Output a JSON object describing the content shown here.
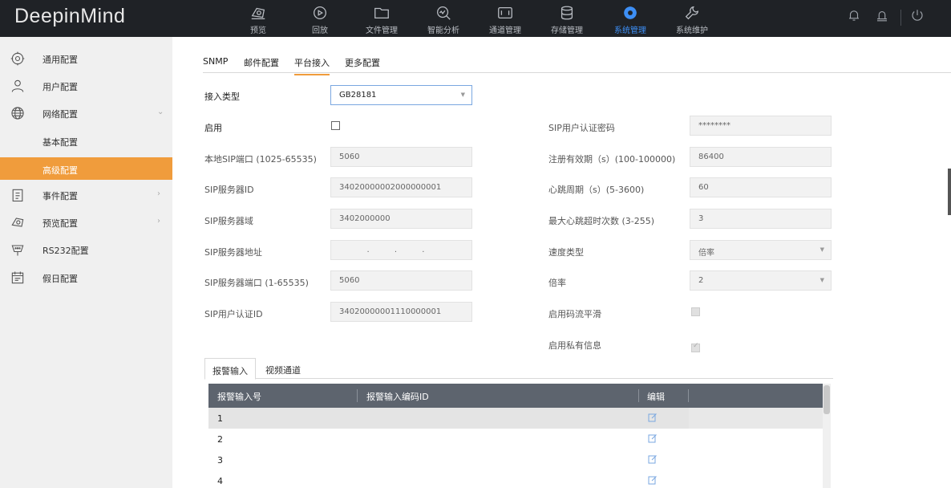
{
  "app": {
    "logo": "DeepinMind"
  },
  "nav": [
    {
      "label": "预览",
      "icon": "preview-icon"
    },
    {
      "label": "回放",
      "icon": "playback-icon"
    },
    {
      "label": "文件管理",
      "icon": "folder-icon"
    },
    {
      "label": "智能分析",
      "icon": "analysis-icon"
    },
    {
      "label": "通道管理",
      "icon": "channel-icon"
    },
    {
      "label": "存储管理",
      "icon": "database-icon"
    },
    {
      "label": "系统管理",
      "icon": "gear-icon",
      "active": true
    },
    {
      "label": "系统维护",
      "icon": "wrench-icon"
    }
  ],
  "sidebar": {
    "items": [
      {
        "label": "通用配置",
        "icon": "settings-icon"
      },
      {
        "label": "用户配置",
        "icon": "user-icon"
      },
      {
        "label": "网络配置",
        "icon": "globe-icon"
      },
      {
        "label": "基本配置"
      },
      {
        "label": "高级配置",
        "active": true
      },
      {
        "label": "事件配置",
        "icon": "clipboard-icon"
      },
      {
        "label": "预览配置",
        "icon": "preview-icon"
      },
      {
        "label": "RS232配置",
        "icon": "rs232-icon"
      },
      {
        "label": "假日配置",
        "icon": "calendar-icon"
      }
    ]
  },
  "tabs": [
    "SNMP",
    "邮件配置",
    "平台接入",
    "更多配置"
  ],
  "form": {
    "access_type_label": "接入类型",
    "access_type_value": "GB28181",
    "enable_label": "启用",
    "local_sip_port_label": "本地SIP端口 (1025-65535)",
    "local_sip_port_value": "5060",
    "sip_server_id_label": "SIP服务器ID",
    "sip_server_id_value": "34020000002000000001",
    "sip_server_domain_label": "SIP服务器域",
    "sip_server_domain_value": "3402000000",
    "sip_server_addr_label": "SIP服务器地址",
    "sip_server_addr_value": ". . .",
    "sip_server_port_label": "SIP服务器端口 (1-65535)",
    "sip_server_port_value": "5060",
    "sip_user_auth_id_label": "SIP用户认证ID",
    "sip_user_auth_id_value": "34020000001110000001",
    "sip_user_auth_pwd_label": "SIP用户认证密码",
    "sip_user_auth_pwd_value": "********",
    "reg_validity_label": "注册有效期（s）(100-100000)",
    "reg_validity_value": "86400",
    "heartbeat_label": "心跳周期（s）(5-3600)",
    "heartbeat_value": "60",
    "max_heartbeat_timeout_label": "最大心跳超时次数 (3-255)",
    "max_heartbeat_timeout_value": "3",
    "speed_type_label": "速度类型",
    "speed_type_value": "倍率",
    "rate_label": "倍率",
    "rate_value": "2",
    "stream_smoothing_label": "启用码流平滑",
    "private_info_label": "启用私有信息"
  },
  "subtabs": [
    "报警输入",
    "视频通道"
  ],
  "table": {
    "headers": [
      "报警输入号",
      "报警输入编码ID",
      "编辑"
    ],
    "rows": [
      "1",
      "2",
      "3",
      "4"
    ]
  }
}
